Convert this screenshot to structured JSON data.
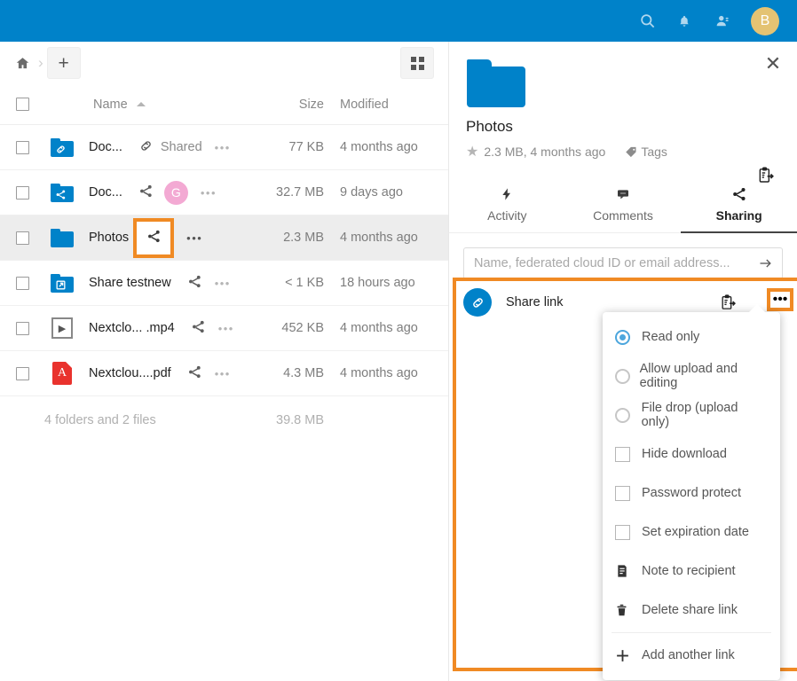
{
  "topbar": {
    "background": "#0082c9",
    "icons": [
      "search-icon",
      "bell-icon",
      "contacts-icon"
    ],
    "avatar_initial": "B",
    "avatar_color": "#e4c373"
  },
  "files": {
    "breadcrumb": {
      "home": "home-icon",
      "separator": "›"
    },
    "new_button_label": "+",
    "view_toggle": "grid-view-icon",
    "columns": {
      "name": "Name",
      "size": "Size",
      "modified": "Modified"
    },
    "rows": [
      {
        "name": "Doc...",
        "icon": "folder-link",
        "share": "Shared",
        "share_icon": "link-icon",
        "avatar": "",
        "size": "77 KB",
        "modified": "4 months ago",
        "selected": false
      },
      {
        "name": "Doc...",
        "icon": "folder-share",
        "share": "",
        "share_icon": "share-icon",
        "avatar": "G",
        "size": "32.7 MB",
        "modified": "9 days ago",
        "selected": false
      },
      {
        "name": "Photos",
        "icon": "folder",
        "share": "",
        "share_icon": "share-icon",
        "avatar": "",
        "size": "2.3 MB",
        "modified": "4 months ago",
        "selected": true
      },
      {
        "name": "Share testnew",
        "icon": "folder-external",
        "share": "",
        "share_icon": "share-icon",
        "avatar": "",
        "size": "< 1 KB",
        "modified": "18 hours ago",
        "selected": false
      },
      {
        "name": "Nextclo... .mp4",
        "icon": "video",
        "share": "",
        "share_icon": "share-icon",
        "avatar": "",
        "size": "452 KB",
        "modified": "4 months ago",
        "selected": false
      },
      {
        "name": "Nextclou....pdf",
        "icon": "pdf",
        "share": "",
        "share_icon": "share-icon",
        "avatar": "",
        "size": "4.3 MB",
        "modified": "4 months ago",
        "selected": false
      }
    ],
    "footer": {
      "count": "4 folders and 2 files",
      "total_size": "39.8 MB"
    },
    "actions_label": "•••"
  },
  "sidebar": {
    "close_label": "✕",
    "file_name": "Photos",
    "meta": "2.3 MB, 4 months ago",
    "tags_label": "Tags",
    "copy_icon": "clipboard-copy-icon",
    "tabs": [
      {
        "label": "Activity",
        "icon": "activity-icon",
        "active": false
      },
      {
        "label": "Comments",
        "icon": "comments-icon",
        "active": false
      },
      {
        "label": "Sharing",
        "icon": "share-icon",
        "active": true
      }
    ],
    "share_input_placeholder": "Name, federated cloud ID or email address...",
    "share_input_value": "",
    "share_link": {
      "label": "Share link",
      "icon": "link-icon",
      "copy_icon": "clipboard-copy-icon",
      "menu_toggle": "•••"
    },
    "menu": [
      {
        "label": "Read only",
        "control": "radio",
        "checked": true
      },
      {
        "label": "Allow upload and editing",
        "control": "radio",
        "checked": false
      },
      {
        "label": "File drop (upload only)",
        "control": "radio",
        "checked": false
      },
      {
        "label": "Hide download",
        "control": "checkbox",
        "checked": false
      },
      {
        "label": "Password protect",
        "control": "checkbox",
        "checked": false
      },
      {
        "label": "Set expiration date",
        "control": "checkbox",
        "checked": false
      },
      {
        "label": "Note to recipient",
        "control": "icon",
        "icon": "note-icon"
      },
      {
        "label": "Delete share link",
        "control": "icon",
        "icon": "trash-icon"
      },
      {
        "label": "Add another link",
        "control": "icon",
        "icon": "plus-icon",
        "separator_above": true
      }
    ]
  },
  "highlights": {
    "color": "#f08a24"
  }
}
